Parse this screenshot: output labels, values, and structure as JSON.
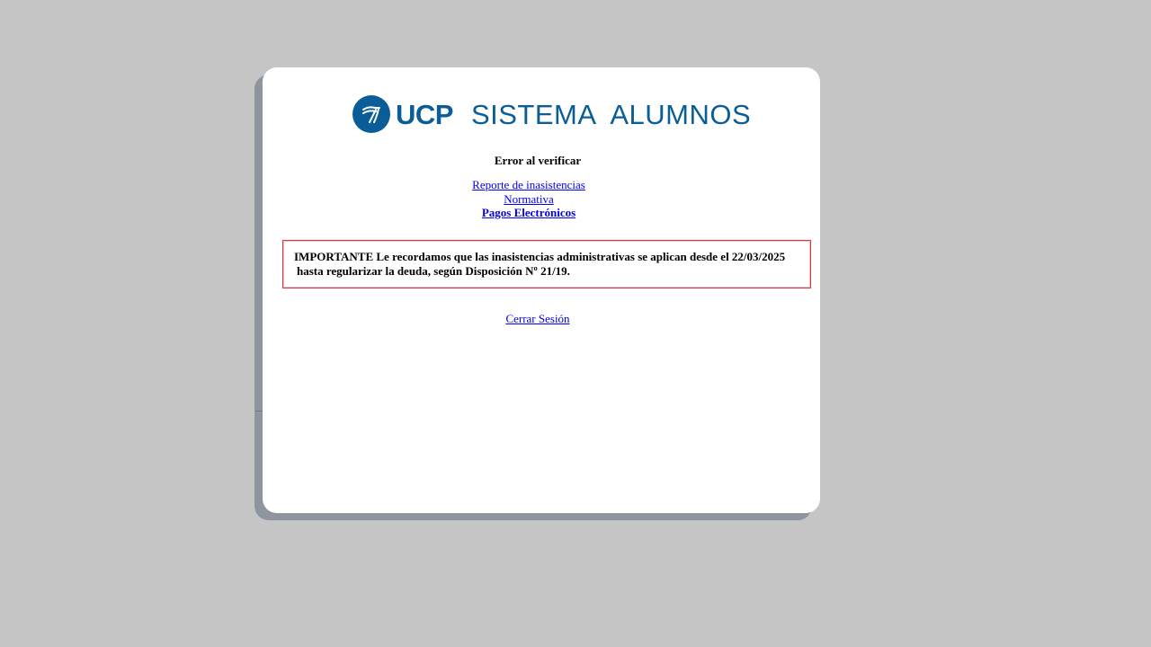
{
  "logo": {
    "brand": "UCP",
    "system_name": "SISTEMA  ALUMNOS",
    "icon": "ucp-logo-icon",
    "brand_color": "#0a5d96"
  },
  "status_message": "Error al verificar",
  "links": {
    "absence_report": "Reporte de inasistencias",
    "regulations": "Normativa",
    "electronic_payments": "Pagos Electrónicos"
  },
  "notice": {
    "line1": "IMPORTANTE Le recordamos que las inasistencias administrativas se aplican desde el 22/03/2025",
    "line2": "hasta regularizar la deuda, según Disposición Nº 21/19.",
    "border_color": "#d9363e"
  },
  "logout_label": "Cerrar Sesión",
  "colors": {
    "background": "#c5c5c5",
    "link": "#0000ee"
  }
}
